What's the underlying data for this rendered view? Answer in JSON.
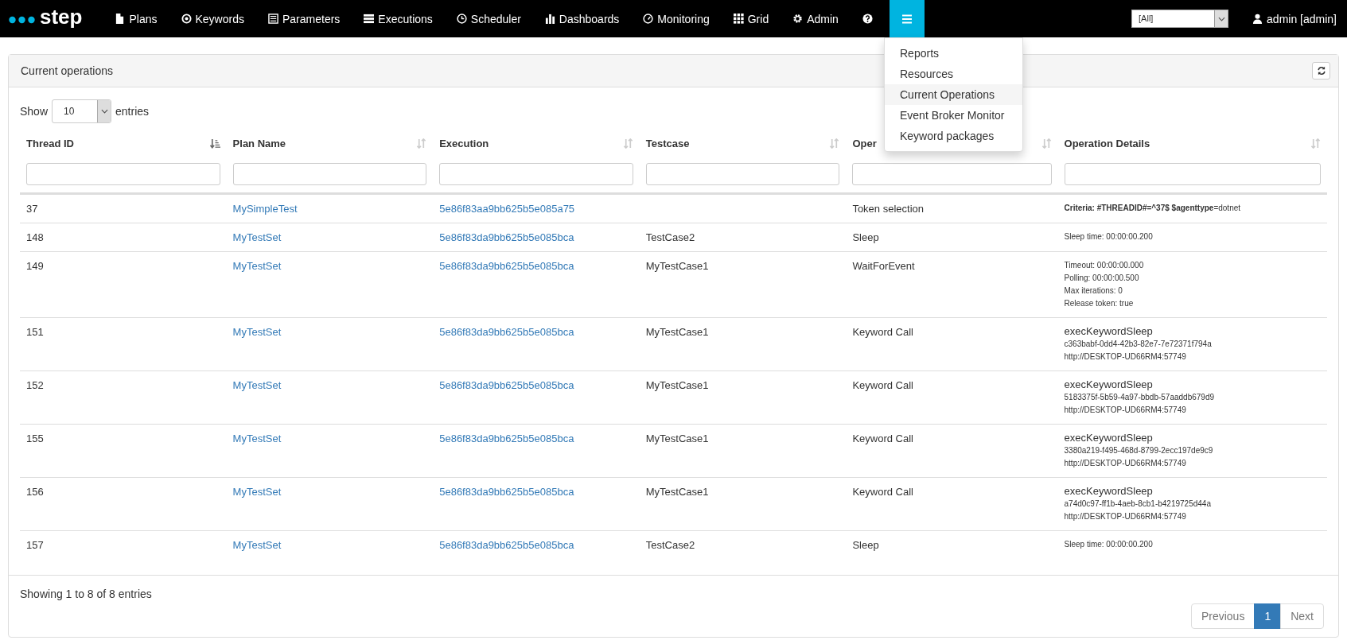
{
  "navbar": {
    "brand": "step",
    "items": [
      {
        "label": "Plans"
      },
      {
        "label": "Keywords"
      },
      {
        "label": "Parameters"
      },
      {
        "label": "Executions"
      },
      {
        "label": "Scheduler"
      },
      {
        "label": "Dashboards"
      },
      {
        "label": "Monitoring"
      },
      {
        "label": "Grid"
      },
      {
        "label": "Admin"
      }
    ],
    "menu_button": {
      "expanded": true
    },
    "tenant_select": {
      "value": "[All]"
    },
    "user": "admin [admin]"
  },
  "menu": [
    {
      "label": "Reports",
      "selected": false
    },
    {
      "label": "Resources",
      "selected": false
    },
    {
      "label": "Current Operations",
      "selected": true
    },
    {
      "label": "Event Broker Monitor",
      "selected": false
    },
    {
      "label": "Keyword packages",
      "selected": false
    }
  ],
  "panel": {
    "title": "Current operations"
  },
  "length": {
    "show": "Show",
    "value": "10",
    "entries": "entries"
  },
  "table": {
    "columns": [
      {
        "label": "Thread ID",
        "sorted": true
      },
      {
        "label": "Plan Name",
        "sorted": false
      },
      {
        "label": "Execution",
        "sorted": false
      },
      {
        "label": "Testcase",
        "sorted": false
      },
      {
        "label": "Oper",
        "sorted": false
      },
      {
        "label": "Operation Details",
        "sorted": false
      }
    ],
    "rows": [
      {
        "thread": "37",
        "plan": "MySimpleTest",
        "execution": "5e86f83aa9bb625b5e085a75",
        "operation": "Token selection",
        "details": {
          "kind": "small",
          "lines": [
            "**Criteria: #THREADID#=^37$ $agenttype**=dotnet"
          ]
        }
      },
      {
        "thread": "148",
        "plan": "MyTestSet",
        "execution": "5e86f83da9bb625b5e085bca",
        "testcase": "TestCase2",
        "operation": "Sleep",
        "details": {
          "kind": "small",
          "lines": [
            "Sleep time: 00:00:00.200"
          ]
        }
      },
      {
        "thread": "149",
        "plan": "MyTestSet",
        "execution": "5e86f83da9bb625b5e085bca",
        "testcase": "MyTestCase1",
        "operation": "WaitForEvent",
        "details": {
          "kind": "small",
          "lines": [
            "Timeout: 00:00:00.000",
            "Polling: 00:00:00.500",
            "Max iterations: 0",
            "Release token: true"
          ]
        }
      },
      {
        "thread": "151",
        "plan": "MyTestSet",
        "execution": "5e86f83da9bb625b5e085bca",
        "testcase": "MyTestCase1",
        "operation": "Keyword Call",
        "details": {
          "kind": "keyword",
          "title": "execKeywordSleep",
          "lines": [
            "c363babf-0dd4-42b3-82e7-7e72371f794a",
            "http://DESKTOP-UD66RM4:57749"
          ]
        }
      },
      {
        "thread": "152",
        "plan": "MyTestSet",
        "execution": "5e86f83da9bb625b5e085bca",
        "testcase": "MyTestCase1",
        "operation": "Keyword Call",
        "details": {
          "kind": "keyword",
          "title": "execKeywordSleep",
          "lines": [
            "5183375f-5b59-4a97-bbdb-57aaddb679d9",
            "http://DESKTOP-UD66RM4:57749"
          ]
        }
      },
      {
        "thread": "155",
        "plan": "MyTestSet",
        "execution": "5e86f83da9bb625b5e085bca",
        "testcase": "MyTestCase1",
        "operation": "Keyword Call",
        "details": {
          "kind": "keyword",
          "title": "execKeywordSleep",
          "lines": [
            "3380a219-f495-468d-8799-2ecc197de9c9",
            "http://DESKTOP-UD66RM4:57749"
          ]
        }
      },
      {
        "thread": "156",
        "plan": "MyTestSet",
        "execution": "5e86f83da9bb625b5e085bca",
        "testcase": "MyTestCase1",
        "operation": "Keyword Call",
        "details": {
          "kind": "keyword",
          "title": "execKeywordSleep",
          "lines": [
            "a74d0c97-ff1b-4aeb-8cb1-b4219725d44a",
            "http://DESKTOP-UD66RM4:57749"
          ]
        }
      },
      {
        "thread": "157",
        "plan": "MyTestSet",
        "execution": "5e86f83da9bb625b5e085bca",
        "testcase": "TestCase2",
        "operation": "Sleep",
        "details": {
          "kind": "small",
          "lines": [
            "Sleep time: 00:00:00.200"
          ]
        }
      }
    ]
  },
  "info": "Showing 1 to 8 of 8 entries",
  "pagination": [
    {
      "label": "Previous",
      "selected": false
    },
    {
      "label": "1",
      "selected": true
    },
    {
      "label": "Next",
      "selected": false
    }
  ]
}
